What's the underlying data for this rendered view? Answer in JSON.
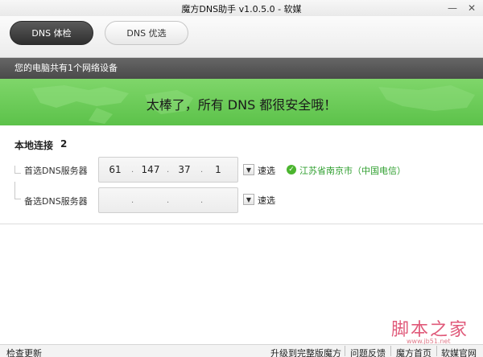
{
  "window": {
    "title": "魔方DNS助手 v1.0.5.0 - 软媒",
    "minimize_glyph": "—",
    "close_glyph": "✕"
  },
  "tabs": [
    {
      "label": "DNS 体检",
      "active": true
    },
    {
      "label": "DNS 优选",
      "active": false
    }
  ],
  "info_bar": {
    "text": "您的电脑共有1个网络设备"
  },
  "banner": {
    "message": "太棒了，所有 DNS 都很安全哦！",
    "color": "#66c652"
  },
  "connection": {
    "name": "本地连接",
    "count": "2",
    "primary": {
      "label": "首选DNS服务器",
      "ip": [
        "61",
        "147",
        "37",
        "1"
      ],
      "speed_label": "速选",
      "dropdown_glyph": "▼",
      "location": "江苏省南京市（中国电信）",
      "check_glyph": "✓"
    },
    "secondary": {
      "label": "备选DNS服务器",
      "ip": [
        "",
        "",
        "",
        ""
      ],
      "speed_label": "速选",
      "dropdown_glyph": "▼"
    }
  },
  "status_bar": {
    "check_update": "检查更新",
    "upgrade": "升级到完整版魔方",
    "feedback": "问题反馈",
    "mofang_home": "魔方首页",
    "ruanmei_home": "软媒官网"
  },
  "watermark": {
    "text": "脚本之家",
    "sub": "www.jb51.net"
  }
}
